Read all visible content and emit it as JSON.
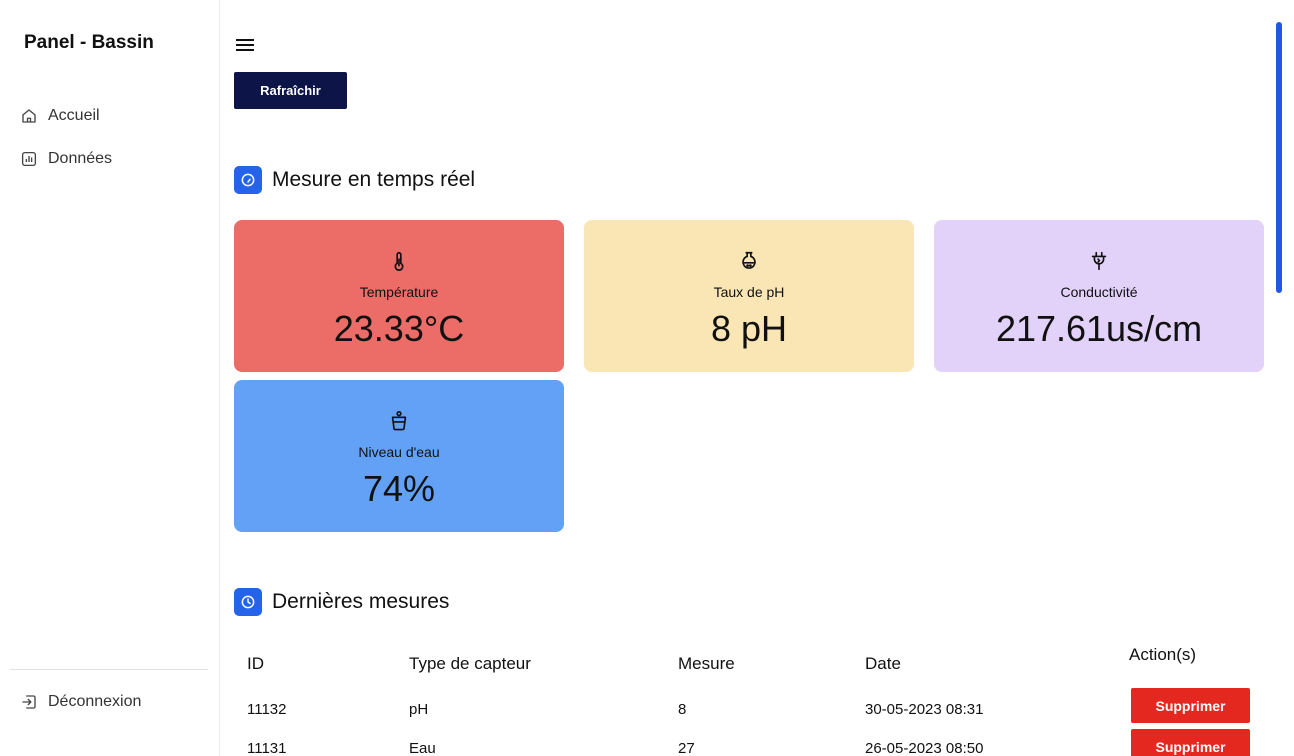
{
  "sidebar": {
    "title": "Panel - Bassin",
    "items": [
      {
        "label": "Accueil",
        "icon": "home-icon"
      },
      {
        "label": "Données",
        "icon": "chart-icon"
      }
    ],
    "logout": {
      "label": "Déconnexion",
      "icon": "logout-icon"
    }
  },
  "toolbar": {
    "menu_icon": "hamburger-icon",
    "refresh_label": "Rafraîchir"
  },
  "realtime": {
    "title": "Mesure en temps réel",
    "icon": "gauge-icon",
    "cards": [
      {
        "label": "Température",
        "value": "23.33°C",
        "icon": "thermometer-icon",
        "color": "#ec6c68"
      },
      {
        "label": "Taux de pH",
        "value": "8 pH",
        "icon": "flask-icon",
        "color": "#fae5b5"
      },
      {
        "label": "Conductivité",
        "value": "217.61us/cm",
        "icon": "plug-icon",
        "color": "#e2d1f8"
      },
      {
        "label": "Niveau d'eau",
        "value": "74%",
        "icon": "water-glass-icon",
        "color": "#63a1f6"
      }
    ]
  },
  "latest": {
    "title": "Dernières mesures",
    "icon": "clock-icon",
    "columns": [
      "ID",
      "Type de capteur",
      "Mesure",
      "Date",
      "Action(s)"
    ],
    "rows": [
      {
        "id": "11132",
        "type": "pH",
        "mesure": "8",
        "date": "30-05-2023 08:31",
        "action": "Supprimer"
      },
      {
        "id": "11131",
        "type": "Eau",
        "mesure": "27",
        "date": "26-05-2023 08:50",
        "action": "Supprimer"
      }
    ]
  },
  "colors": {
    "accent": "#2563eb",
    "primary_button": "#0d1447",
    "danger_button": "#e5281f"
  }
}
